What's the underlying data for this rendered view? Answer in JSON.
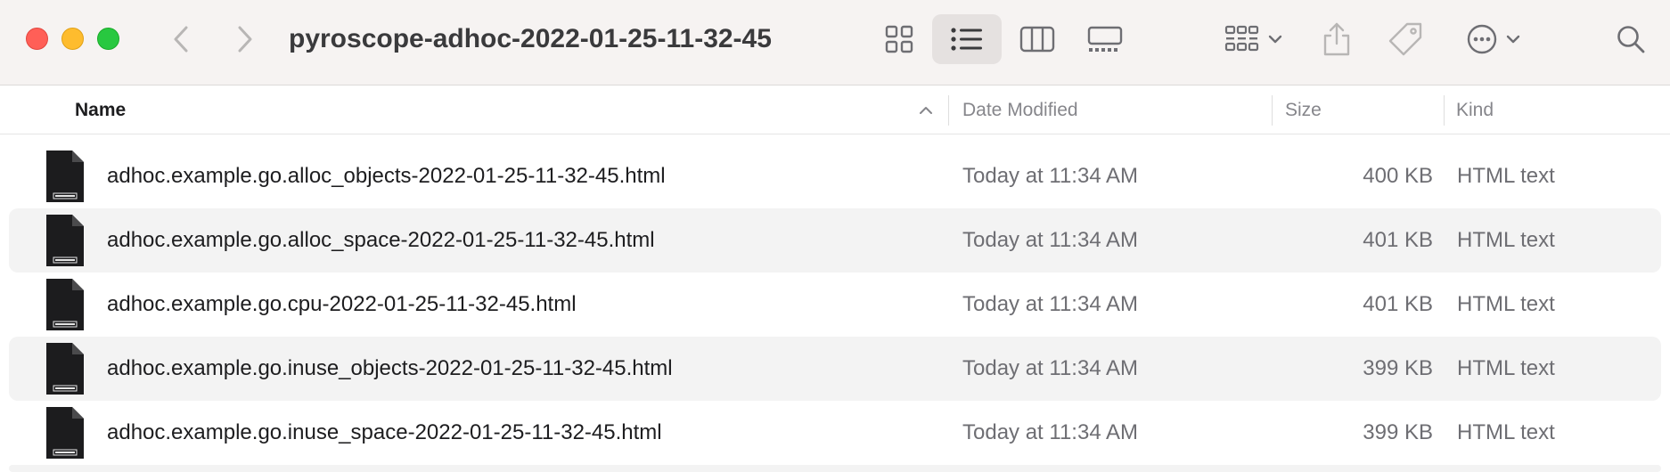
{
  "toolbar": {
    "title": "pyroscope-adhoc-2022-01-25-11-32-45",
    "icons": {
      "back": "chevron-left-icon",
      "forward": "chevron-right-icon",
      "view_icon": "grid-view-icon",
      "view_list": "list-view-icon",
      "view_column": "column-view-icon",
      "view_gallery": "gallery-view-icon",
      "group": "group-icon",
      "share": "share-icon",
      "tag": "tag-icon",
      "action": "ellipsis-circle-icon",
      "search": "search-icon"
    },
    "active_view": "list"
  },
  "columns": {
    "name": "Name",
    "date_modified": "Date Modified",
    "size": "Size",
    "kind": "Kind",
    "sort": "ascending"
  },
  "files": [
    {
      "name": "adhoc.example.go.alloc_objects-2022-01-25-11-32-45.html",
      "date": "Today at 11:34 AM",
      "size": "400 KB",
      "kind": "HTML text"
    },
    {
      "name": "adhoc.example.go.alloc_space-2022-01-25-11-32-45.html",
      "date": "Today at 11:34 AM",
      "size": "401 KB",
      "kind": "HTML text"
    },
    {
      "name": "adhoc.example.go.cpu-2022-01-25-11-32-45.html",
      "date": "Today at 11:34 AM",
      "size": "401 KB",
      "kind": "HTML text"
    },
    {
      "name": "adhoc.example.go.inuse_objects-2022-01-25-11-32-45.html",
      "date": "Today at 11:34 AM",
      "size": "399 KB",
      "kind": "HTML text"
    },
    {
      "name": "adhoc.example.go.inuse_space-2022-01-25-11-32-45.html",
      "date": "Today at 11:34 AM",
      "size": "399 KB",
      "kind": "HTML text"
    }
  ],
  "colors": {
    "close": "#ff5f57",
    "minimize": "#febc2e",
    "zoom": "#28c840",
    "toolbar_bg": "#f6f3f2",
    "row_alt": "#f3f3f3"
  }
}
